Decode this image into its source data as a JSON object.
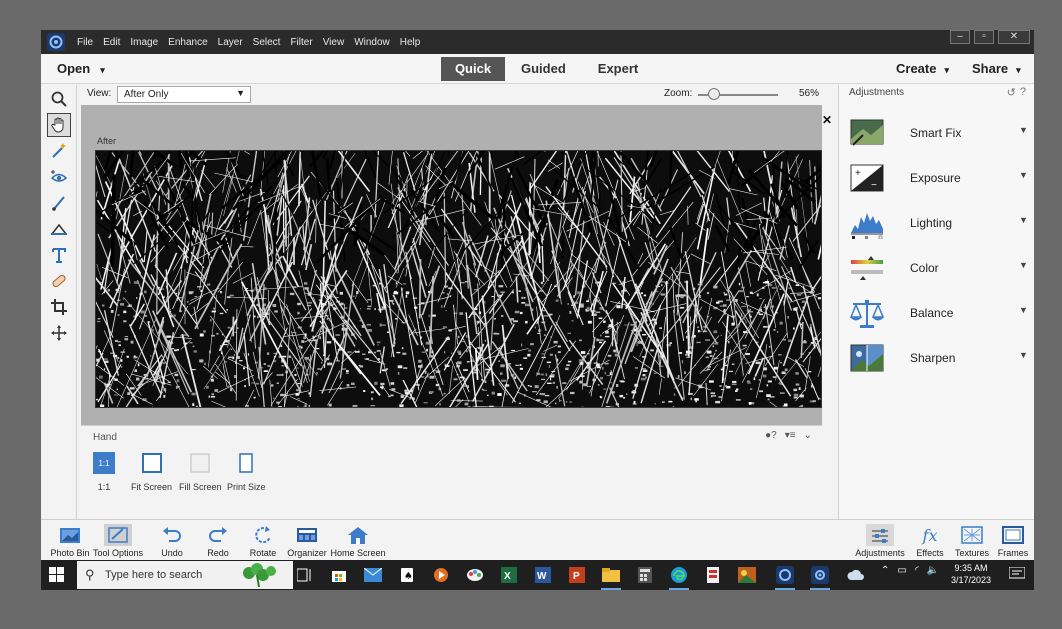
{
  "menubar": {
    "items": [
      "File",
      "Edit",
      "Image",
      "Enhance",
      "Layer",
      "Select",
      "Filter",
      "View",
      "Window",
      "Help"
    ],
    "window_controls": [
      "–",
      "▫",
      "✕"
    ]
  },
  "modebar": {
    "open_label": "Open",
    "tabs": [
      "Quick",
      "Guided",
      "Expert"
    ],
    "active_tab": "Quick",
    "create_label": "Create",
    "share_label": "Share"
  },
  "options": {
    "view_label": "View:",
    "view_value": "After Only",
    "zoom_label": "Zoom:",
    "zoom_value": "56%",
    "zoom_fraction": 0.2
  },
  "canvas": {
    "after_label": "After",
    "close_glyph": "✕"
  },
  "hand_panel": {
    "title": "Hand",
    "options": [
      {
        "label": "1:1",
        "glyph": "1:1"
      },
      {
        "label": "Fit Screen"
      },
      {
        "label": "Fill Screen"
      },
      {
        "label": "Print Size"
      }
    ]
  },
  "adjustments": {
    "title": "Adjustments",
    "items": [
      {
        "label": "Smart Fix",
        "icon": "smart-fix-icon"
      },
      {
        "label": "Exposure",
        "icon": "exposure-icon"
      },
      {
        "label": "Lighting",
        "icon": "lighting-icon"
      },
      {
        "label": "Color",
        "icon": "color-icon"
      },
      {
        "label": "Balance",
        "icon": "balance-icon"
      },
      {
        "label": "Sharpen",
        "icon": "sharpen-icon"
      }
    ]
  },
  "bottombar": {
    "left": [
      "Photo Bin",
      "Tool Options",
      "Undo",
      "Redo",
      "Rotate",
      "Organizer",
      "Home Screen"
    ],
    "right": [
      "Adjustments",
      "Effects",
      "Textures",
      "Frames"
    ]
  },
  "taskbar": {
    "search_placeholder": "Type here to search",
    "time": "9:35 AM",
    "date": "3/17/2023"
  },
  "colors": {
    "accent": "#2f6fb5",
    "taskbar": "#1f1f1f",
    "menubar": "#2b2b2b"
  }
}
